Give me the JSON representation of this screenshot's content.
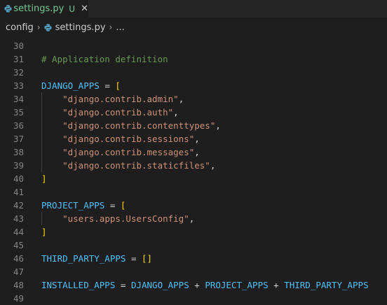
{
  "tab": {
    "filename": "settings.py",
    "status": "U",
    "close_glyph": "✕"
  },
  "breadcrumbs": {
    "folder": "config",
    "file": "settings.py",
    "more": "..."
  },
  "colors": {
    "background": "#1e1e1e",
    "tab_modified": "#73c991",
    "comment": "#6a9955",
    "variable": "#4fc1ff",
    "string": "#ce9178",
    "bracket": "#ffd700",
    "line_number": "#858585"
  },
  "editor": {
    "lines": [
      {
        "num": "30",
        "tokens": []
      },
      {
        "num": "31",
        "tokens": [
          {
            "t": "# Application definition",
            "c": "t-comment"
          }
        ]
      },
      {
        "num": "32",
        "tokens": []
      },
      {
        "num": "33",
        "tokens": [
          {
            "t": "DJANGO_APPS",
            "c": "t-var"
          },
          {
            "t": " = ",
            "c": "t-op"
          },
          {
            "t": "[",
            "c": "t-br1"
          }
        ]
      },
      {
        "num": "34",
        "tokens": [
          {
            "t": "    ",
            "c": "t-op"
          },
          {
            "t": "\"django.contrib.admin\"",
            "c": "t-str"
          },
          {
            "t": ",",
            "c": "t-op"
          }
        ]
      },
      {
        "num": "35",
        "tokens": [
          {
            "t": "    ",
            "c": "t-op"
          },
          {
            "t": "\"django.contrib.auth\"",
            "c": "t-str"
          },
          {
            "t": ",",
            "c": "t-op"
          }
        ]
      },
      {
        "num": "36",
        "tokens": [
          {
            "t": "    ",
            "c": "t-op"
          },
          {
            "t": "\"django.contrib.contenttypes\"",
            "c": "t-str"
          },
          {
            "t": ",",
            "c": "t-op"
          }
        ]
      },
      {
        "num": "37",
        "tokens": [
          {
            "t": "    ",
            "c": "t-op"
          },
          {
            "t": "\"django.contrib.sessions\"",
            "c": "t-str"
          },
          {
            "t": ",",
            "c": "t-op"
          }
        ]
      },
      {
        "num": "38",
        "tokens": [
          {
            "t": "    ",
            "c": "t-op"
          },
          {
            "t": "\"django.contrib.messages\"",
            "c": "t-str"
          },
          {
            "t": ",",
            "c": "t-op"
          }
        ]
      },
      {
        "num": "39",
        "tokens": [
          {
            "t": "    ",
            "c": "t-op"
          },
          {
            "t": "\"django.contrib.staticfiles\"",
            "c": "t-str"
          },
          {
            "t": ",",
            "c": "t-op"
          }
        ]
      },
      {
        "num": "40",
        "tokens": [
          {
            "t": "]",
            "c": "t-br1"
          }
        ]
      },
      {
        "num": "41",
        "tokens": []
      },
      {
        "num": "42",
        "tokens": [
          {
            "t": "PROJECT_APPS",
            "c": "t-var"
          },
          {
            "t": " = ",
            "c": "t-op"
          },
          {
            "t": "[",
            "c": "t-br1"
          }
        ]
      },
      {
        "num": "43",
        "tokens": [
          {
            "t": "    ",
            "c": "t-op"
          },
          {
            "t": "\"users.apps.UsersConfig\"",
            "c": "t-str"
          },
          {
            "t": ",",
            "c": "t-op"
          }
        ]
      },
      {
        "num": "44",
        "tokens": [
          {
            "t": "]",
            "c": "t-br1"
          }
        ]
      },
      {
        "num": "45",
        "tokens": []
      },
      {
        "num": "46",
        "tokens": [
          {
            "t": "THIRD_PARTY_APPS",
            "c": "t-var"
          },
          {
            "t": " = ",
            "c": "t-op"
          },
          {
            "t": "[]",
            "c": "t-br1"
          }
        ]
      },
      {
        "num": "47",
        "tokens": []
      },
      {
        "num": "48",
        "tokens": [
          {
            "t": "INSTALLED_APPS",
            "c": "t-var"
          },
          {
            "t": " = ",
            "c": "t-op"
          },
          {
            "t": "DJANGO_APPS",
            "c": "t-var"
          },
          {
            "t": " + ",
            "c": "t-op"
          },
          {
            "t": "PROJECT_APPS",
            "c": "t-var"
          },
          {
            "t": " + ",
            "c": "t-op"
          },
          {
            "t": "THIRD_PARTY_APPS",
            "c": "t-var"
          }
        ]
      },
      {
        "num": "49",
        "tokens": []
      }
    ]
  }
}
